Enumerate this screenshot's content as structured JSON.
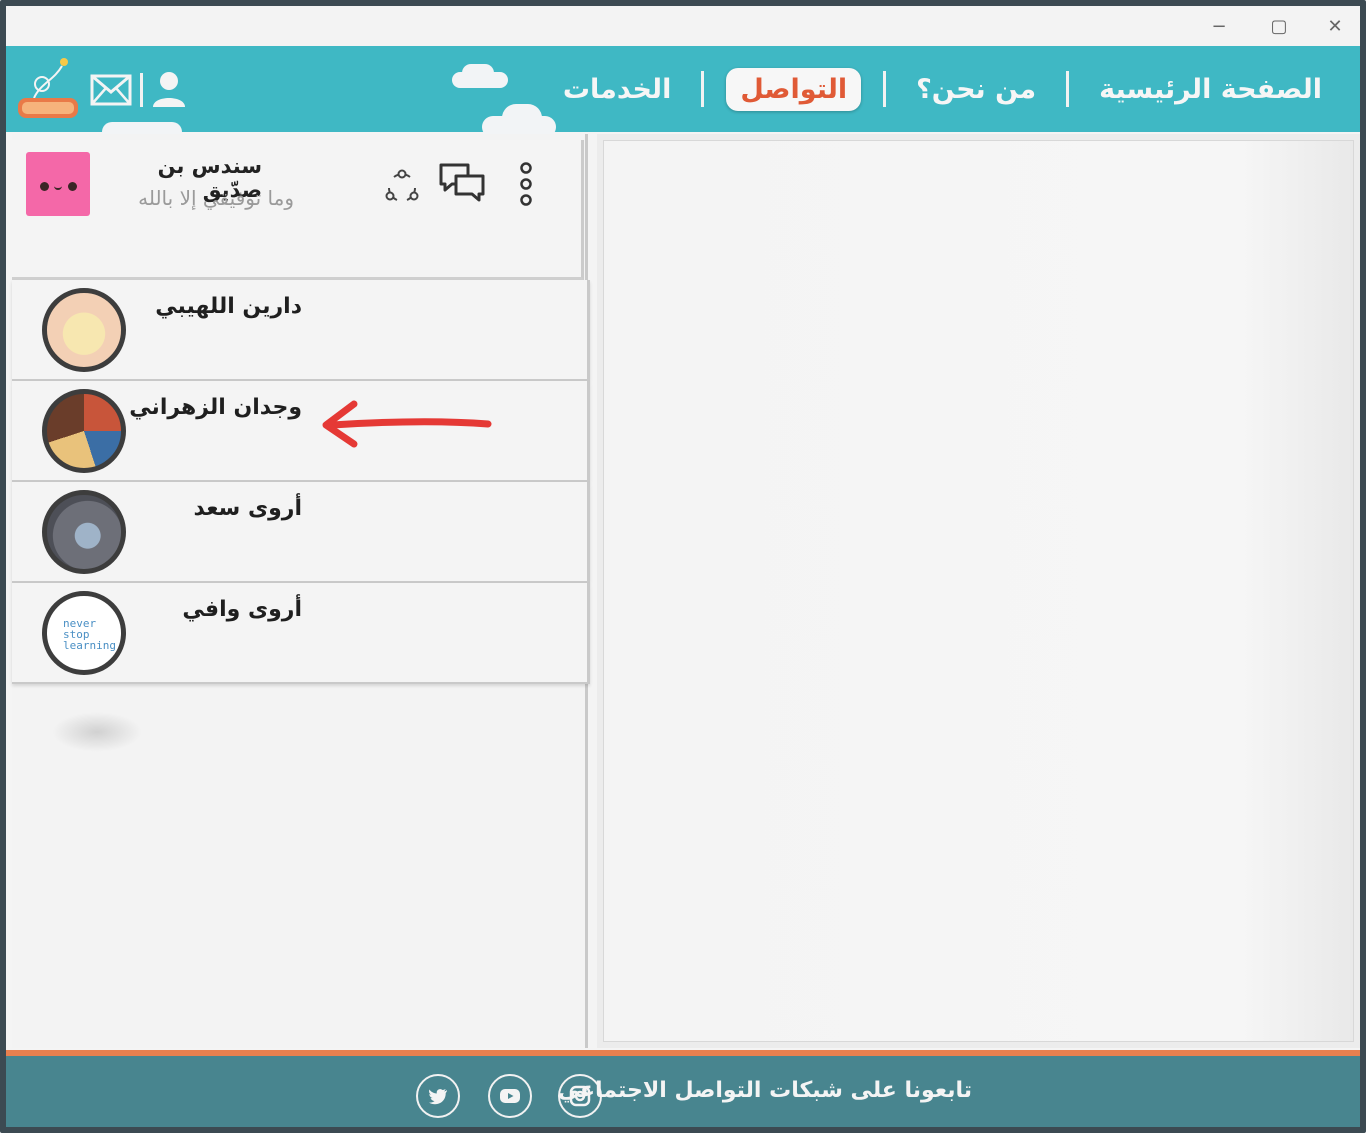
{
  "window": {
    "minimize": "−",
    "maximize": "▢",
    "close": "✕"
  },
  "nav": {
    "items": [
      "الصفحة الرئيسية",
      "من نحن؟",
      "التواصل",
      "الخدمات"
    ],
    "active": "التواصل"
  },
  "header_icons": [
    "logo",
    "mail-icon",
    "user-icon"
  ],
  "profile": {
    "name": "سندس بن صدّيق",
    "status": "وما توفيقي إلا بالله",
    "icons": [
      "share-icon",
      "chat-icon",
      "more-icon"
    ]
  },
  "contacts": [
    {
      "name": "دارين اللهيبي"
    },
    {
      "name": "وجدان الزهراني"
    },
    {
      "name": "أروى سعد"
    },
    {
      "name": "أروى وافي",
      "avatar_text": "never stop learning"
    }
  ],
  "footer": {
    "text": "تابعونا على شبكات التواصل الاجتماعي",
    "social": [
      "instagram-icon",
      "youtube-icon",
      "twitter-icon"
    ]
  },
  "colors": {
    "header": "#3fb8c4",
    "accent": "#e05a36",
    "footer": "#48858f",
    "footer_line": "#e8804f",
    "annotation_arrow": "#e53935"
  }
}
